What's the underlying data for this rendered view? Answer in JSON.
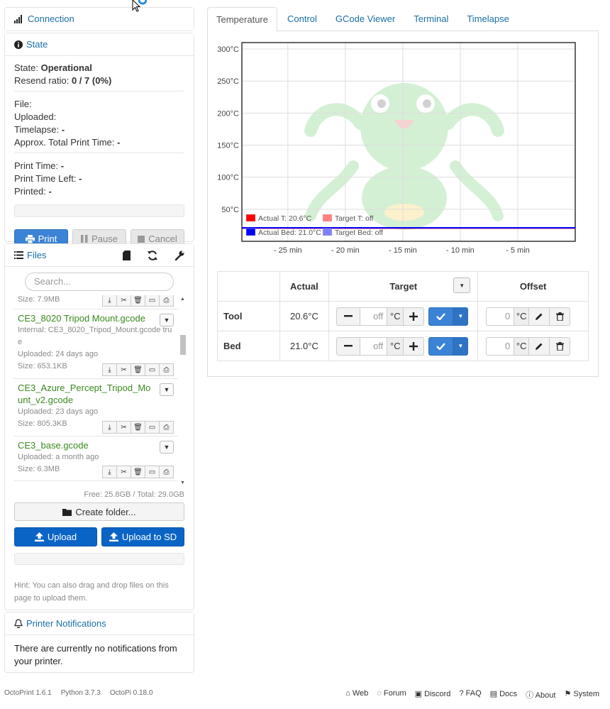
{
  "connection": {
    "title": "Connection"
  },
  "state": {
    "title": "State",
    "state_label": "State:",
    "state_value": "Operational",
    "resend_label": "Resend ratio:",
    "resend_value": "0 / 7 (0%)",
    "file_label": "File:",
    "uploaded_label": "Uploaded:",
    "timelapse_label": "Timelapse:",
    "timelapse_value": "-",
    "approx_label": "Approx. Total Print Time:",
    "approx_value": "-",
    "print_time_label": "Print Time:",
    "print_time_value": "-",
    "print_left_label": "Print Time Left:",
    "print_left_value": "-",
    "printed_label": "Printed:",
    "printed_value": "-",
    "buttons": {
      "print": "Print",
      "pause": "Pause",
      "cancel": "Cancel"
    }
  },
  "files": {
    "title": "Files",
    "search_placeholder": "Search...",
    "items": [
      {
        "size": "Size: 7.9MB"
      },
      {
        "name": "CE3_8020 Tripod Mount.gcode",
        "internal": "Internal: CE3_8020_Tripod_Mount.gcode true",
        "uploaded": "Uploaded: 24 days ago",
        "size": "Size: 653.1KB"
      },
      {
        "name": "CE3_Azure_Percept_Tripod_Mount_v2.gcode",
        "uploaded": "Uploaded: 23 days ago",
        "size": "Size: 805.3KB"
      },
      {
        "name": "CE3_base.gcode",
        "uploaded": "Uploaded: a month ago",
        "size": "Size: 6.3MB"
      }
    ],
    "free_total": "Free: 25.8GB / Total: 29.0GB",
    "create_folder": "Create folder...",
    "upload": "Upload",
    "upload_sd": "Upload to SD",
    "hint": "Hint: You can also drag and drop files on this page to upload them."
  },
  "notifications": {
    "title": "Printer Notifications",
    "text": "There are currently no notifications from your printer."
  },
  "tabs": [
    "Temperature",
    "Control",
    "GCode Viewer",
    "Terminal",
    "Timelapse"
  ],
  "chart_data": {
    "type": "line",
    "title": "",
    "xlabel": "",
    "ylabel": "",
    "x_ticks": [
      "- 25 min",
      "- 20 min",
      "- 15 min",
      "- 10 min",
      "- 5 min"
    ],
    "y_ticks": [
      "50°C",
      "100°C",
      "150°C",
      "200°C",
      "250°C",
      "300°C"
    ],
    "ylim": [
      0,
      310
    ],
    "xlim": [
      -29,
      0
    ],
    "grid": true,
    "legend_position": "bottom-left",
    "series": [
      {
        "name": "Actual T: 20.6°C",
        "color": "#ff0000",
        "x": [
          -29,
          0
        ],
        "values": [
          20.6,
          20.6
        ]
      },
      {
        "name": "Target T: off",
        "color": "#ff8080",
        "x": [],
        "values": []
      },
      {
        "name": "Actual Bed: 21.0°C",
        "color": "#0000ff",
        "x": [
          -29,
          0
        ],
        "values": [
          21.0,
          21.0
        ]
      },
      {
        "name": "Target Bed: off",
        "color": "#8080ff",
        "x": [],
        "values": []
      }
    ]
  },
  "temp_table": {
    "headers": {
      "actual": "Actual",
      "target": "Target",
      "offset": "Offset"
    },
    "rows": [
      {
        "name": "Tool",
        "actual": "20.6°C",
        "target_placeholder": "off",
        "unit": "°C",
        "offset": "0"
      },
      {
        "name": "Bed",
        "actual": "21.0°C",
        "target_placeholder": "off",
        "unit": "°C",
        "offset": "0"
      }
    ]
  },
  "footer": {
    "left": [
      "OctoPrint 1.6.1",
      "Python 3.7.3",
      "OctoPi 0.18.0"
    ],
    "right": [
      "Web",
      "Forum",
      "Discord",
      "FAQ",
      "Docs",
      "About",
      "System"
    ]
  },
  "colors": {
    "link": "#1a6ea8",
    "primary": "#3b83d6",
    "upload": "#0a64c6",
    "filename": "#3a8a1e"
  }
}
